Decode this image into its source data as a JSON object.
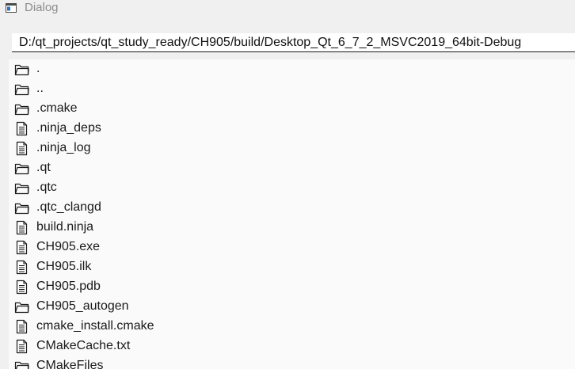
{
  "window": {
    "title": "Dialog",
    "icon": "window-icon"
  },
  "path": {
    "value": "D:/qt_projects/qt_study_ready/CH905/build/Desktop_Qt_6_7_2_MSVC2019_64bit-Debug"
  },
  "entries": [
    {
      "name": ".",
      "icon": "folder-icon"
    },
    {
      "name": "..",
      "icon": "folder-icon"
    },
    {
      "name": ".cmake",
      "icon": "folder-icon"
    },
    {
      "name": ".ninja_deps",
      "icon": "file-icon"
    },
    {
      "name": ".ninja_log",
      "icon": "file-icon"
    },
    {
      "name": ".qt",
      "icon": "folder-icon"
    },
    {
      "name": ".qtc",
      "icon": "folder-icon"
    },
    {
      "name": ".qtc_clangd",
      "icon": "folder-icon"
    },
    {
      "name": "build.ninja",
      "icon": "file-icon"
    },
    {
      "name": "CH905.exe",
      "icon": "file-icon"
    },
    {
      "name": "CH905.ilk",
      "icon": "file-icon"
    },
    {
      "name": "CH905.pdb",
      "icon": "file-icon"
    },
    {
      "name": "CH905_autogen",
      "icon": "folder-icon"
    },
    {
      "name": "cmake_install.cmake",
      "icon": "file-icon"
    },
    {
      "name": "CMakeCache.txt",
      "icon": "file-icon"
    },
    {
      "name": "CMakeFiles",
      "icon": "folder-icon"
    }
  ]
}
